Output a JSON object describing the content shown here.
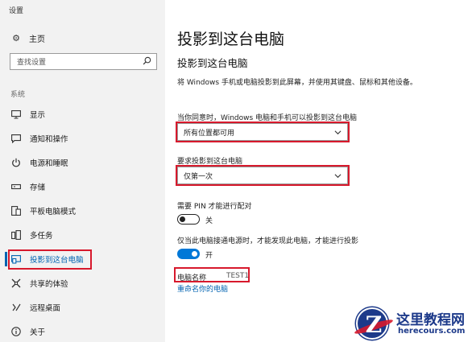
{
  "window": {
    "title": "设置"
  },
  "sidebar": {
    "home_label": "主页",
    "search_placeholder": "查找设置",
    "group_label": "系统",
    "items": [
      {
        "label": "显示",
        "icon": "monitor-icon"
      },
      {
        "label": "通知和操作",
        "icon": "notification-icon"
      },
      {
        "label": "电源和睡眠",
        "icon": "power-icon"
      },
      {
        "label": "存储",
        "icon": "storage-icon"
      },
      {
        "label": "平板电脑模式",
        "icon": "tablet-mode-icon"
      },
      {
        "label": "多任务",
        "icon": "multitasking-icon"
      },
      {
        "label": "投影到这台电脑",
        "icon": "project-icon",
        "selected": true
      },
      {
        "label": "共享的体验",
        "icon": "shared-experience-icon"
      },
      {
        "label": "远程桌面",
        "icon": "remote-desktop-icon"
      },
      {
        "label": "关于",
        "icon": "info-icon"
      }
    ]
  },
  "main": {
    "page_title": "投影到这台电脑",
    "section_title": "投影到这台电脑",
    "description": "将 Windows 手机或电脑投影到此屏幕，并使用其键盘、鼠标和其他设备。",
    "availability": {
      "label": "当你同意时，Windows 电脑和手机可以投影到这台电脑",
      "value": "所有位置都可用"
    },
    "ask_to_project": {
      "label": "要求投影到这台电脑",
      "value": "仅第一次"
    },
    "require_pin": {
      "label": "需要 PIN 才能进行配对",
      "state": "关",
      "on": false
    },
    "plugged_in_only": {
      "label": "仅当此电脑接通电源时，才能发现此电脑，才能进行投影",
      "state": "开",
      "on": true
    },
    "pc_name": {
      "label": "电脑名称",
      "value": "TEST1"
    },
    "rename_link": "重命名你的电脑"
  },
  "watermark": {
    "letter": "Z",
    "brand_cn": "这里教程网",
    "brand_en": "herecours.com"
  },
  "colors": {
    "accent": "#0063b1",
    "toggle_on": "#0078d7",
    "highlight": "#d7192c",
    "sidebar_bg": "#f2f2f2",
    "logo_blue": "#1d3a8a"
  }
}
